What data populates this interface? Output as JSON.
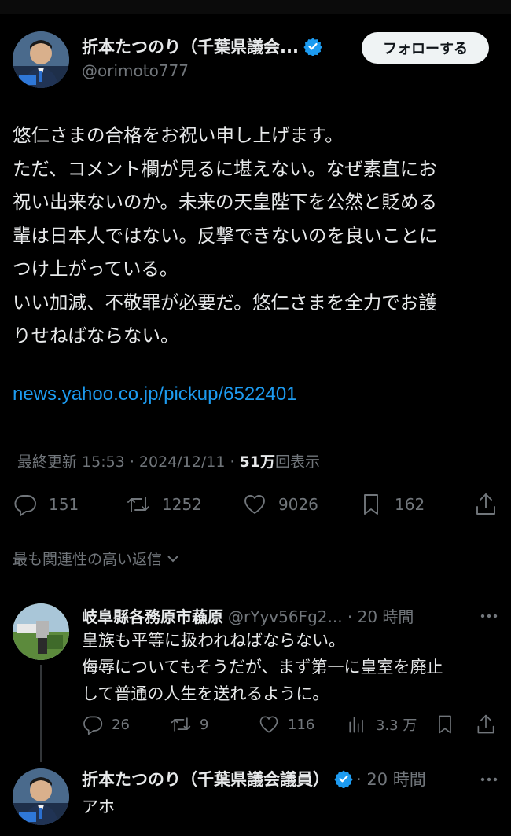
{
  "tweet": {
    "author_name": "折本たつのり（千葉県議会...",
    "handle": "@orimoto777",
    "follow_label": "フォローする",
    "text_lines": [
      "悠仁さまの合格をお祝い申し上げます。",
      "ただ、コメント欄が見るに堪えない。なぜ素直にお",
      "祝い出来ないのか。未来の天皇陛下を公然と貶める",
      "輩は日本人ではない。反撃できないのを良いことに",
      "つけ上がっている。",
      "いい加減、不敬罪が必要だ。悠仁さまを全力でお護",
      "りせねばならない。"
    ],
    "link": "news.yahoo.co.jp/pickup/6522401",
    "meta_prefix": "最終更新 15:53 · 2024/12/11 · ",
    "views_count": "51万",
    "views_suffix": "回表示",
    "stats": {
      "replies": "151",
      "reposts": "1252",
      "likes": "9026",
      "bookmarks": "162"
    }
  },
  "relevant_label": "最も関連性の高い返信",
  "replies": [
    {
      "name": "岐阜縣各務原市蘓原",
      "handle_time": "@rYyv56Fg2... · 20 時間",
      "text_lines": [
        "皇族も平等に扱われねばならない。",
        "侮辱についてもそうだが、まず第一に皇室を廃止",
        "して普通の人生を送れるように。"
      ],
      "stats": {
        "replies": "26",
        "reposts": "9",
        "likes": "116",
        "views": "3.3 万"
      }
    },
    {
      "name": "折本たつのり（千葉県議会議員）",
      "time": "· 20 時間",
      "text": "アホ"
    }
  ],
  "colors": {
    "background": "#000000",
    "text": "#e7e9ea",
    "secondary": "#71767b",
    "link": "#1d9bf0",
    "verified": "#1d9bf0"
  }
}
